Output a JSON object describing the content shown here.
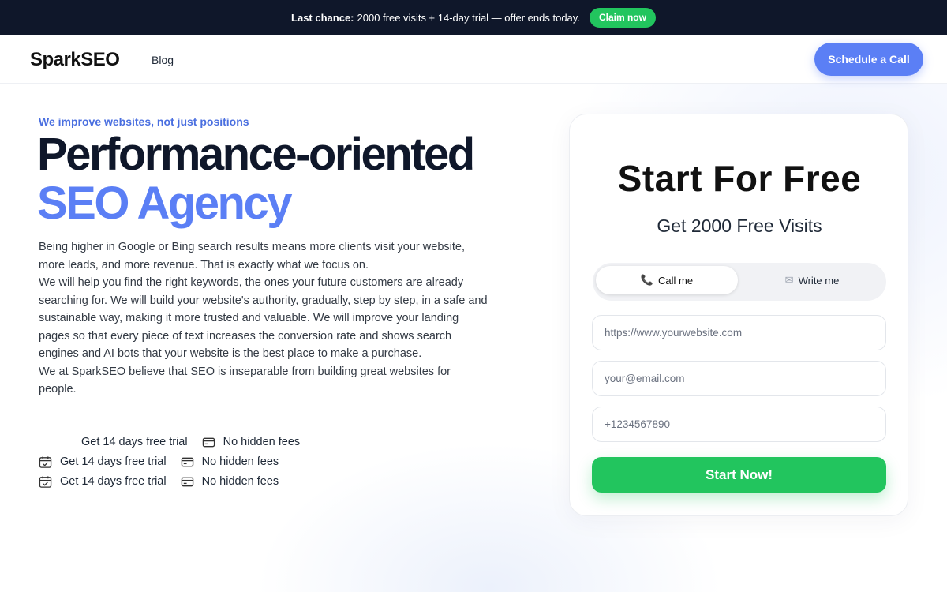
{
  "announcement": {
    "strong": "Last chance:",
    "text": "2000 free visits + 14-day trial — offer ends today.",
    "cta": "Claim now"
  },
  "header": {
    "logo": "SparkSEO",
    "nav": [
      "Blog"
    ],
    "cta": "Schedule a Call"
  },
  "hero": {
    "eyebrow": "We improve websites, not just positions",
    "title_line1": "Performance-oriented",
    "title_line2": "SEO Agency",
    "paragraphs": [
      "Being higher in Google or Bing search results means more clients visit your website, more leads, and more revenue. That is exactly what we focus on.",
      "We will help you find the right keywords, the ones your future customers are already searching for. We will build your website's authority, gradually, step by step, in a safe and sustainable way, making it more trusted and valuable. We will improve your landing pages so that every piece of text increases the conversion rate and shows search engines and AI bots that your website is the best place to make a purchase.",
      "We at SparkSEO believe that SEO is inseparable from building great websites for people."
    ],
    "features": [
      {
        "trial": "Get 14 days free trial",
        "fees": "No hidden fees",
        "trial_icon": false
      },
      {
        "trial": "Get 14 days free trial",
        "fees": "No hidden fees",
        "trial_icon": true
      },
      {
        "trial": "Get 14 days free trial",
        "fees": "No hidden fees",
        "trial_icon": true
      }
    ],
    "icons": {
      "trial": "calendar-check-icon",
      "fees": "credit-card-icon"
    }
  },
  "signup": {
    "title": "Start For Free",
    "subtitle": "Get 2000 Free Visits",
    "toggle": {
      "call": "Call me",
      "write": "Write me",
      "selected": "Call me",
      "call_icon": "phone-icon",
      "write_icon": "envelope-icon"
    },
    "fields": {
      "website_placeholder": "https://www.yourwebsite.com",
      "email_placeholder": "your@email.com",
      "phone_placeholder": "+1234567890"
    },
    "submit": "Start Now!"
  },
  "colors": {
    "accent": "#5b7ff5",
    "green": "#22c55e",
    "dark": "#0f172a"
  }
}
